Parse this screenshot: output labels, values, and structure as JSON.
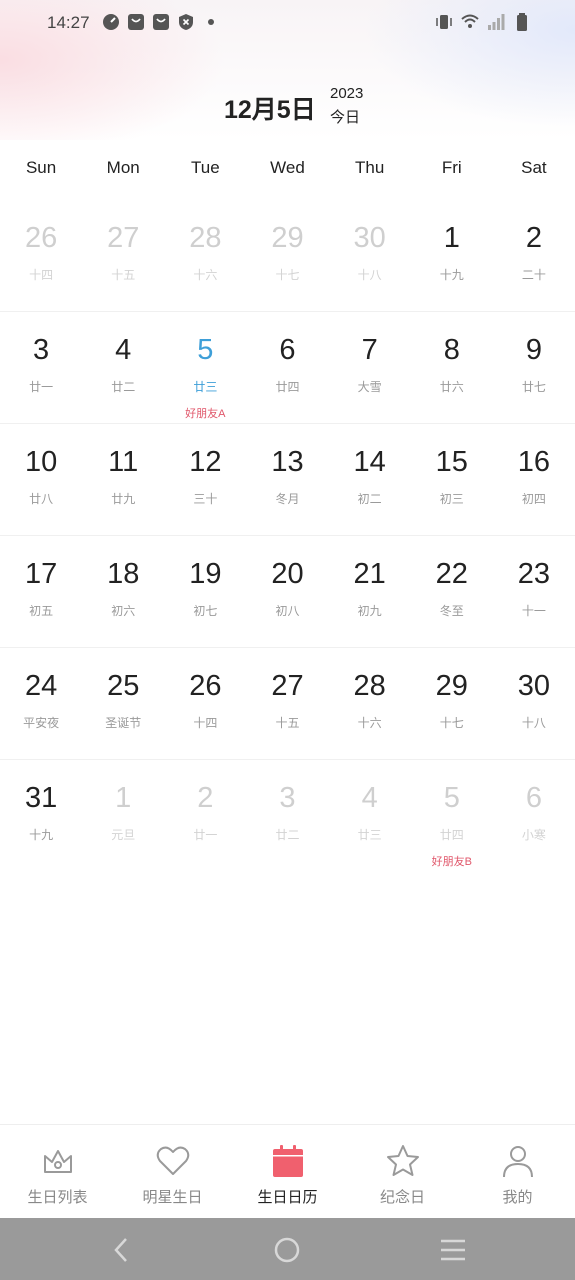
{
  "status_bar": {
    "time": "14:27",
    "left_icons": [
      "speedometer-icon",
      "shopping-bag-icon",
      "shopping-bag-icon",
      "shield-x-icon",
      "dot-icon"
    ],
    "right_icons": [
      "vibrate-icon",
      "wifi-icon",
      "signal-icon",
      "battery-icon"
    ]
  },
  "header": {
    "date": "12月5日",
    "year": "2023",
    "today_label": "今日"
  },
  "weekdays": [
    "Sun",
    "Mon",
    "Tue",
    "Wed",
    "Thu",
    "Fri",
    "Sat"
  ],
  "calendar": {
    "weeks": [
      [
        {
          "day": "26",
          "lunar": "十四",
          "state": "other"
        },
        {
          "day": "27",
          "lunar": "十五",
          "state": "other"
        },
        {
          "day": "28",
          "lunar": "十六",
          "state": "other"
        },
        {
          "day": "29",
          "lunar": "十七",
          "state": "other"
        },
        {
          "day": "30",
          "lunar": "十八",
          "state": "other"
        },
        {
          "day": "1",
          "lunar": "十九",
          "state": "current"
        },
        {
          "day": "2",
          "lunar": "二十",
          "state": "current"
        }
      ],
      [
        {
          "day": "3",
          "lunar": "廿一",
          "state": "current"
        },
        {
          "day": "4",
          "lunar": "廿二",
          "state": "current"
        },
        {
          "day": "5",
          "lunar": "廿三",
          "state": "today",
          "event": "好朋友A"
        },
        {
          "day": "6",
          "lunar": "廿四",
          "state": "current"
        },
        {
          "day": "7",
          "lunar": "大雪",
          "state": "current"
        },
        {
          "day": "8",
          "lunar": "廿六",
          "state": "current"
        },
        {
          "day": "9",
          "lunar": "廿七",
          "state": "current"
        }
      ],
      [
        {
          "day": "10",
          "lunar": "廿八",
          "state": "current"
        },
        {
          "day": "11",
          "lunar": "廿九",
          "state": "current"
        },
        {
          "day": "12",
          "lunar": "三十",
          "state": "current"
        },
        {
          "day": "13",
          "lunar": "冬月",
          "state": "current"
        },
        {
          "day": "14",
          "lunar": "初二",
          "state": "current"
        },
        {
          "day": "15",
          "lunar": "初三",
          "state": "current"
        },
        {
          "day": "16",
          "lunar": "初四",
          "state": "current"
        }
      ],
      [
        {
          "day": "17",
          "lunar": "初五",
          "state": "current"
        },
        {
          "day": "18",
          "lunar": "初六",
          "state": "current"
        },
        {
          "day": "19",
          "lunar": "初七",
          "state": "current"
        },
        {
          "day": "20",
          "lunar": "初八",
          "state": "current"
        },
        {
          "day": "21",
          "lunar": "初九",
          "state": "current"
        },
        {
          "day": "22",
          "lunar": "冬至",
          "state": "current"
        },
        {
          "day": "23",
          "lunar": "十一",
          "state": "current"
        }
      ],
      [
        {
          "day": "24",
          "lunar": "平安夜",
          "state": "current"
        },
        {
          "day": "25",
          "lunar": "圣诞节",
          "state": "current"
        },
        {
          "day": "26",
          "lunar": "十四",
          "state": "current"
        },
        {
          "day": "27",
          "lunar": "十五",
          "state": "current"
        },
        {
          "day": "28",
          "lunar": "十六",
          "state": "current"
        },
        {
          "day": "29",
          "lunar": "十七",
          "state": "current"
        },
        {
          "day": "30",
          "lunar": "十八",
          "state": "current"
        }
      ],
      [
        {
          "day": "31",
          "lunar": "十九",
          "state": "current"
        },
        {
          "day": "1",
          "lunar": "元旦",
          "state": "other"
        },
        {
          "day": "2",
          "lunar": "廿一",
          "state": "other"
        },
        {
          "day": "3",
          "lunar": "廿二",
          "state": "other"
        },
        {
          "day": "4",
          "lunar": "廿三",
          "state": "other"
        },
        {
          "day": "5",
          "lunar": "廿四",
          "state": "other",
          "event": "好朋友B"
        },
        {
          "day": "6",
          "lunar": "小寒",
          "state": "other"
        }
      ]
    ]
  },
  "tabbar": {
    "tabs": [
      {
        "label": "生日列表",
        "icon": "crown-icon",
        "active": false
      },
      {
        "label": "明星生日",
        "icon": "heart-icon",
        "active": false
      },
      {
        "label": "生日日历",
        "icon": "calendar-icon",
        "active": true
      },
      {
        "label": "纪念日",
        "icon": "star-icon",
        "active": false
      },
      {
        "label": "我的",
        "icon": "person-icon",
        "active": false
      }
    ]
  },
  "colors": {
    "accent": "#f0606e",
    "today": "#3e9fd8",
    "event": "#e0566a",
    "inactive_icon": "#9a9a9a"
  }
}
